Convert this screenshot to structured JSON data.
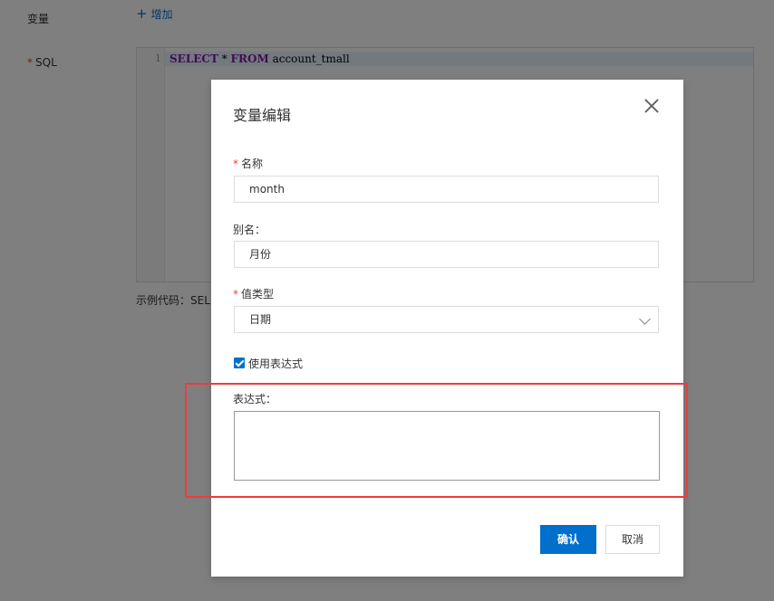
{
  "background": {
    "variables_label": "变量",
    "add_label": "增加",
    "sql_label": "SQL",
    "line_number": "1",
    "code": {
      "kw1": "SELECT",
      "star": " * ",
      "kw2": "FROM",
      "table": " account_tmall"
    },
    "example_label": "示例代码：SEL"
  },
  "modal": {
    "title": "变量编辑",
    "name_label": "名称",
    "name_value": "month",
    "alias_label": "别名：",
    "alias_value": "月份",
    "type_label": "值类型",
    "type_value": "日期",
    "use_expression_label": "使用表达式",
    "use_expression_checked": true,
    "expression_label": "表达式：",
    "expression_value": "",
    "confirm_label": "确认",
    "cancel_label": "取消"
  },
  "colors": {
    "primary": "#0070cc",
    "required": "#f04134",
    "highlight": "#ee3c3c"
  }
}
